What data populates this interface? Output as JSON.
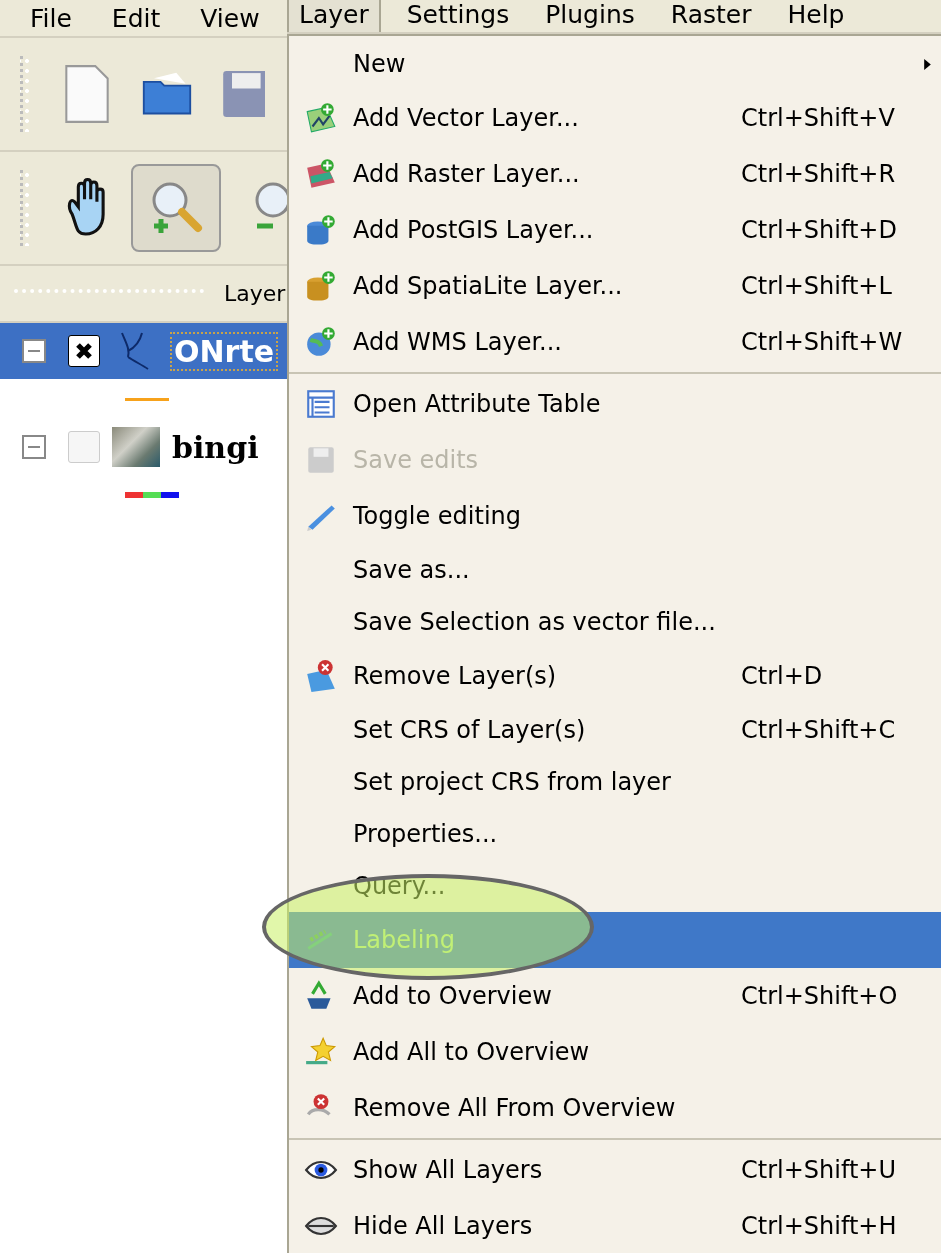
{
  "menubar": [
    {
      "label": "File",
      "selected": false
    },
    {
      "label": "Edit",
      "selected": false
    },
    {
      "label": "View",
      "selected": false
    },
    {
      "label": "Layer",
      "selected": true
    },
    {
      "label": "Settings",
      "selected": false
    },
    {
      "label": "Plugins",
      "selected": false
    },
    {
      "label": "Raster",
      "selected": false
    },
    {
      "label": "Help",
      "selected": false
    }
  ],
  "layers_panel": {
    "title": "Layer",
    "layers": [
      {
        "name": "ONrte",
        "checked": true,
        "selected": true,
        "kind": "line"
      },
      {
        "name": "bingi",
        "checked": false,
        "selected": false,
        "kind": "raster"
      }
    ]
  },
  "menu": [
    {
      "kind": "item",
      "label": "New",
      "submenu": true,
      "disabled": false,
      "selected": false
    },
    {
      "kind": "item",
      "label": "Add Vector Layer...",
      "shortcut": "Ctrl+Shift+V",
      "disabled": false,
      "selected": false
    },
    {
      "kind": "item",
      "label": "Add Raster Layer...",
      "shortcut": "Ctrl+Shift+R",
      "disabled": false,
      "selected": false
    },
    {
      "kind": "item",
      "label": "Add PostGIS Layer...",
      "shortcut": "Ctrl+Shift+D",
      "disabled": false,
      "selected": false
    },
    {
      "kind": "item",
      "label": "Add SpatiaLite Layer...",
      "shortcut": "Ctrl+Shift+L",
      "disabled": false,
      "selected": false
    },
    {
      "kind": "item",
      "label": "Add WMS Layer...",
      "shortcut": "Ctrl+Shift+W",
      "disabled": false,
      "selected": false
    },
    {
      "kind": "separator"
    },
    {
      "kind": "item",
      "label": "Open Attribute Table",
      "disabled": false,
      "selected": false
    },
    {
      "kind": "item",
      "label": "Save edits",
      "disabled": true,
      "selected": false
    },
    {
      "kind": "item",
      "label": "Toggle editing",
      "disabled": false,
      "selected": false
    },
    {
      "kind": "item",
      "label": "Save as...",
      "disabled": false,
      "selected": false
    },
    {
      "kind": "item",
      "label": "Save Selection as vector file...",
      "disabled": false,
      "selected": false
    },
    {
      "kind": "item",
      "label": "Remove Layer(s)",
      "shortcut": "Ctrl+D",
      "disabled": false,
      "selected": false
    },
    {
      "kind": "item",
      "label": "Set CRS of Layer(s)",
      "shortcut": "Ctrl+Shift+C",
      "disabled": false,
      "selected": false
    },
    {
      "kind": "item",
      "label": "Set project CRS from layer",
      "disabled": false,
      "selected": false
    },
    {
      "kind": "item",
      "label": "Properties...",
      "disabled": false,
      "selected": false
    },
    {
      "kind": "item",
      "label": "Query...",
      "disabled": false,
      "selected": false
    },
    {
      "kind": "item",
      "label": "Labeling",
      "disabled": false,
      "selected": true
    },
    {
      "kind": "item",
      "label": "Add to Overview",
      "shortcut": "Ctrl+Shift+O",
      "disabled": false,
      "selected": false
    },
    {
      "kind": "item",
      "label": "Add All to Overview",
      "disabled": false,
      "selected": false
    },
    {
      "kind": "item",
      "label": "Remove All From Overview",
      "disabled": false,
      "selected": false
    },
    {
      "kind": "separator"
    },
    {
      "kind": "item",
      "label": "Show All Layers",
      "shortcut": "Ctrl+Shift+U",
      "disabled": false,
      "selected": false
    },
    {
      "kind": "item",
      "label": "Hide All Layers",
      "shortcut": "Ctrl+Shift+H",
      "disabled": false,
      "selected": false
    }
  ]
}
